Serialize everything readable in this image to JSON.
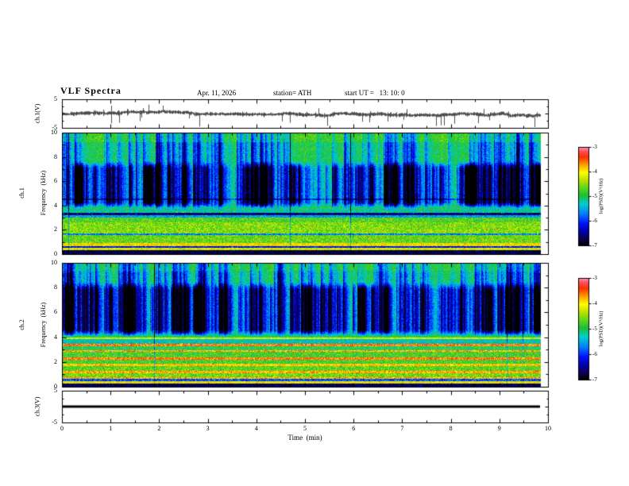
{
  "figure": {
    "title": "VLF  Spectra",
    "date": "Apr. 11, 2026",
    "station_label": "station= ATH",
    "start_ut_label": "start UT =   13: 10: 0"
  },
  "chart_data": {
    "type": "multi-panel",
    "x": {
      "label": "Time  (min)",
      "range": [
        0,
        10
      ],
      "ticks": [
        0,
        1,
        2,
        3,
        4,
        5,
        6,
        7,
        8,
        9,
        10
      ],
      "minor_step": 0.5,
      "data_end": 9.85
    },
    "panels": [
      {
        "id": "ch1_waveform",
        "type": "line",
        "ylabel": "ch.1(V)",
        "ylim": [
          -5,
          5
        ],
        "yticks": [
          5,
          -5
        ],
        "signal": {
          "baseline_V": 0,
          "noise_band_V": 0.8,
          "spike_depth_V": -4,
          "description": "broadband noise around 0 V with frequent negative impulse spikes"
        }
      },
      {
        "id": "ch1_spectrogram",
        "type": "heatmap",
        "ylabel_lines": [
          "ch.1",
          "Frequency  (kHz)"
        ],
        "ylim": [
          0,
          10
        ],
        "yticks": [
          0,
          2,
          4,
          6,
          8,
          10
        ],
        "value_range": [
          -7,
          -3
        ],
        "bands": [
          [
            0.0,
            0.3,
            -6.8
          ],
          [
            0.3,
            0.5,
            -4.2
          ],
          [
            0.5,
            0.68,
            -6.2
          ],
          [
            0.68,
            0.92,
            -4.0
          ],
          [
            0.92,
            1.55,
            -4.65
          ],
          [
            1.55,
            1.72,
            -5.7
          ],
          [
            1.72,
            2.6,
            -4.55
          ],
          [
            2.6,
            3.0,
            -4.75
          ],
          [
            3.0,
            3.22,
            -5.5
          ],
          [
            3.22,
            3.45,
            -6.6
          ],
          [
            3.45,
            3.72,
            -5.2
          ],
          [
            3.72,
            4.45,
            -4.95
          ],
          [
            4.45,
            4.62,
            -5.5
          ],
          [
            4.62,
            9.3,
            -4.95
          ],
          [
            9.3,
            10.0,
            -4.75
          ]
        ],
        "streaks": {
          "fmin": 3.6,
          "density": 0.22,
          "decay": 0.8,
          "gain": 1.5,
          "max": 2.6,
          "extra_band": [
            4.2,
            7.2
          ],
          "extra_density": 0.3
        },
        "speckle": 0.015,
        "seed": 101
      },
      {
        "id": "ch2_spectrogram",
        "type": "heatmap",
        "ylabel_lines": [
          "ch.2",
          "Frequency  (kHz)"
        ],
        "ylim": [
          0,
          10
        ],
        "yticks": [
          0,
          2,
          4,
          6,
          8,
          10
        ],
        "value_range": [
          -7,
          -3
        ],
        "bands": [
          [
            0.0,
            0.25,
            -6.7
          ],
          [
            0.25,
            0.48,
            -4.1
          ],
          [
            0.48,
            0.62,
            -5.9
          ],
          [
            0.62,
            0.8,
            -3.8
          ],
          [
            0.8,
            1.1,
            -4.6
          ],
          [
            1.1,
            1.28,
            -3.8
          ],
          [
            1.28,
            1.7,
            -4.7
          ],
          [
            1.7,
            1.88,
            -3.9
          ],
          [
            1.88,
            2.2,
            -4.8
          ],
          [
            2.2,
            2.38,
            -3.6
          ],
          [
            2.38,
            2.82,
            -4.8
          ],
          [
            2.82,
            2.98,
            -3.8
          ],
          [
            2.98,
            3.3,
            -5.0
          ],
          [
            3.3,
            3.48,
            -3.6
          ],
          [
            3.48,
            3.85,
            -5.3
          ],
          [
            3.85,
            4.0,
            -4.2
          ],
          [
            4.0,
            9.4,
            -4.95
          ],
          [
            9.4,
            10.0,
            -4.8
          ]
        ],
        "streaks": {
          "fmin": 4.0,
          "density": 0.2,
          "decay": 0.8,
          "gain": 1.5,
          "max": 2.6,
          "extra_band": [
            4.5,
            8.0
          ],
          "extra_density": 0.28
        },
        "speckle": 0.03,
        "seed": 202
      },
      {
        "id": "ch3_waveform",
        "type": "line",
        "ylabel": "ch.3(V)",
        "ylim": [
          -5,
          5
        ],
        "yticks": [
          5,
          -5
        ],
        "signal": {
          "baseline_V": 0,
          "flat": true,
          "description": "constant 0 V flat trace"
        }
      }
    ],
    "colorbars": [
      {
        "label": "log(PSD)(V²/Hz)",
        "range": [
          -7,
          -3
        ],
        "ticks": [
          -3,
          -4,
          -5,
          -6,
          -7
        ]
      },
      {
        "label": "log(PSD)(V²/Hz)",
        "range": [
          -7,
          -3
        ],
        "ticks": [
          -3,
          -4,
          -5,
          -6,
          -7
        ]
      }
    ],
    "colormap_stops": [
      [
        0.0,
        "#000000"
      ],
      [
        0.06,
        "#10004a"
      ],
      [
        0.13,
        "#0000a0"
      ],
      [
        0.22,
        "#0010ff"
      ],
      [
        0.32,
        "#0080ff"
      ],
      [
        0.42,
        "#00d0d0"
      ],
      [
        0.51,
        "#1fbf2f"
      ],
      [
        0.58,
        "#55d81e"
      ],
      [
        0.66,
        "#b8e000"
      ],
      [
        0.74,
        "#ffff00"
      ],
      [
        0.82,
        "#ffa000"
      ],
      [
        0.9,
        "#ff3000"
      ],
      [
        0.96,
        "#ff5060"
      ],
      [
        1.0,
        "#ff9ab0"
      ]
    ]
  }
}
